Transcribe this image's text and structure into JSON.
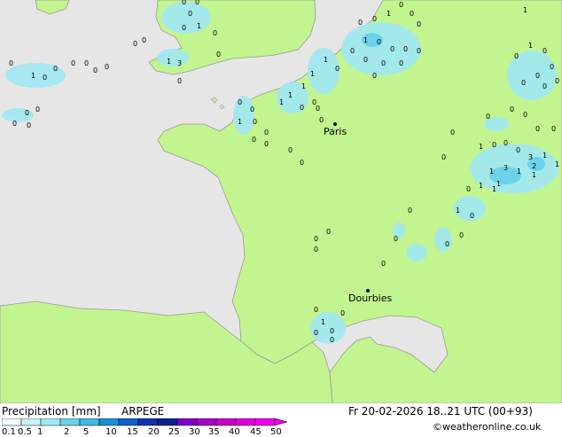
{
  "map": {
    "cities": [
      {
        "name": "Paris"
      },
      {
        "name": "Dourbies"
      }
    ],
    "colors": {
      "sea": "#e6e6e6",
      "land": "#c2f58f",
      "precip_light": "#a0e8f4",
      "precip_mid": "#6cd2ec"
    }
  },
  "footer": {
    "title": "Precipitation [mm]",
    "model": "ARPEGE",
    "datetime": "Fr 20-02-2026 18..21 UTC (00+93)",
    "credit": "©weatheronline.co.uk",
    "scale_labels": [
      "0.1",
      "0.5",
      "1",
      "2",
      "5",
      "10",
      "15",
      "20",
      "25",
      "30",
      "35",
      "40",
      "45",
      "50"
    ],
    "scale_colors": [
      "#f0fcff",
      "#c8f3fb",
      "#a0e8f4",
      "#6cd2ec",
      "#40b8e4",
      "#1890d8",
      "#1060c8",
      "#1030b0",
      "#102090",
      "#8000c8",
      "#a800c8",
      "#c800c8",
      "#e000d8",
      "#f000f0"
    ]
  }
}
